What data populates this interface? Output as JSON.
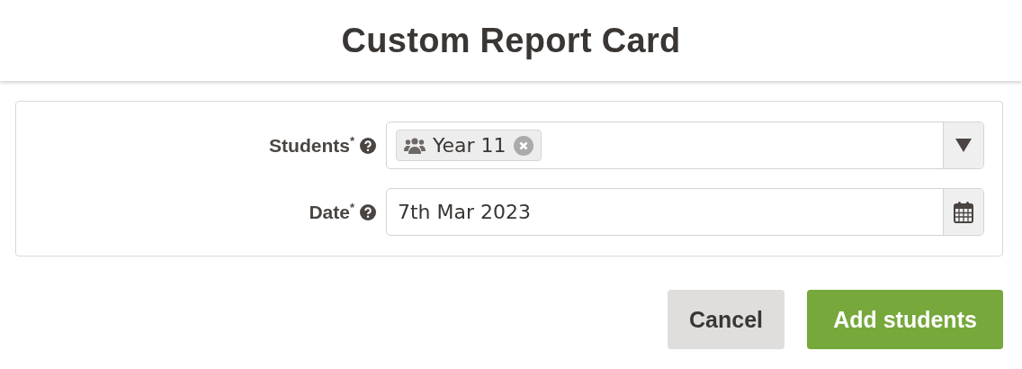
{
  "dialog": {
    "title": "Custom Report Card"
  },
  "fields": [
    {
      "kind": "tags",
      "label": "Students$^{*}$",
      "tags": [
        "Year 11"
      ]
    },
    {
      "kind": "date",
      "label": "Date$^{*}$",
      "value": "7th Mar 2023"
    }
  ],
  "buttons": [
    {
      "label": "Cancel",
      "kind": "secondary"
    },
    {
      "label": "Add students",
      "kind": "primary"
    }
  ]
}
